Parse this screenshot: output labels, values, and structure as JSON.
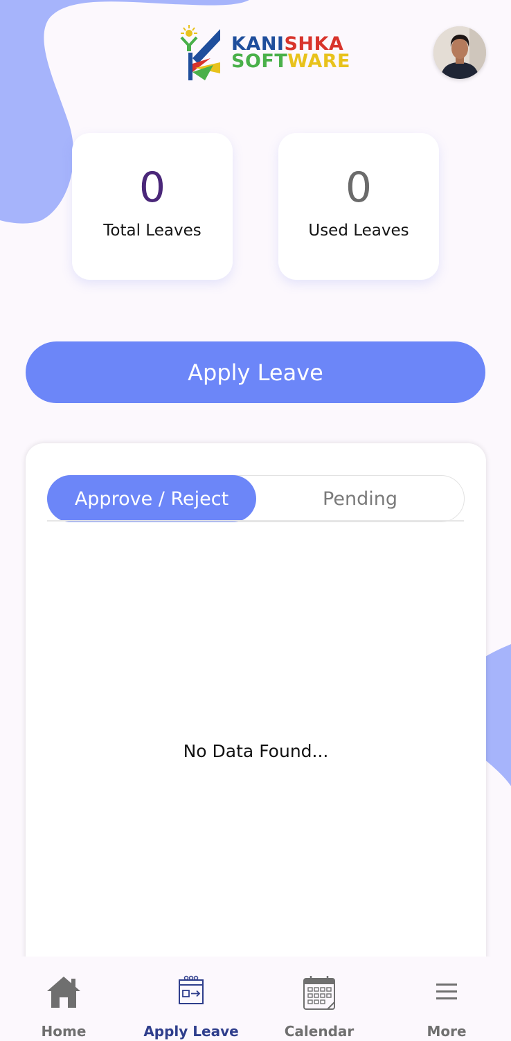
{
  "header": {
    "logo_line1_a": "KANI",
    "logo_line1_b": "SHKA",
    "logo_line2_a": "SOFT",
    "logo_line2_b": "WARE"
  },
  "stats": {
    "total_value": "0",
    "total_label": "Total Leaves",
    "used_value": "0",
    "used_label": "Used Leaves"
  },
  "apply_button_label": "Apply Leave",
  "tabs": {
    "active": "Approve / Reject",
    "inactive": "Pending"
  },
  "empty_message": "No Data Found...",
  "nav": {
    "items": [
      {
        "label": "Home",
        "icon": "home-icon"
      },
      {
        "label": "Apply Leave",
        "icon": "apply-leave-icon"
      },
      {
        "label": "Calendar",
        "icon": "calendar-icon"
      },
      {
        "label": "More",
        "icon": "menu-icon"
      }
    ],
    "active_index": 1
  },
  "colors": {
    "accent": "#6c86f8",
    "background": "#fcf8fd",
    "blob": "#a6b4fb",
    "nav_active": "#2f3e8c"
  }
}
